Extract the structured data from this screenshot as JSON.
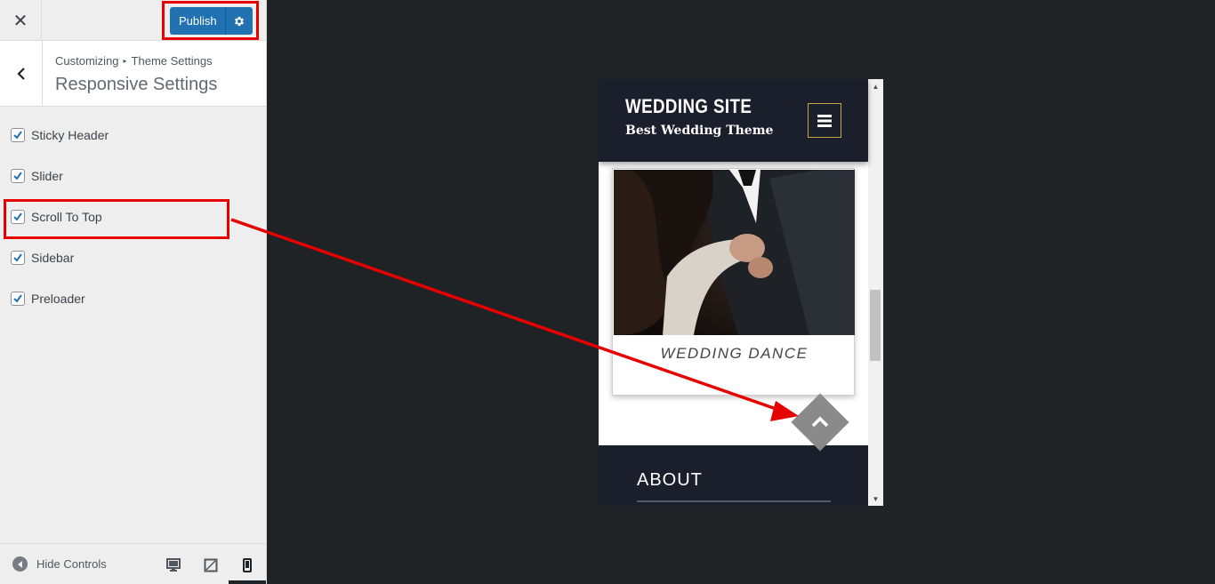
{
  "toolbar": {
    "close_icon": "close-icon",
    "publish_label": "Publish",
    "publish_settings_icon": "gear-icon",
    "accent_color": "#2271b1"
  },
  "section": {
    "breadcrumb_root": "Customizing",
    "breadcrumb_child": "Theme Settings",
    "title": "Responsive Settings"
  },
  "options": [
    {
      "label": "Sticky Header",
      "checked": true
    },
    {
      "label": "Slider",
      "checked": true
    },
    {
      "label": "Scroll To Top",
      "checked": true
    },
    {
      "label": "Sidebar",
      "checked": true
    },
    {
      "label": "Preloader",
      "checked": true
    }
  ],
  "footer": {
    "hide_controls_label": "Hide Controls",
    "devices": [
      "desktop-icon",
      "tablet-icon",
      "mobile-icon"
    ],
    "active_device": "mobile"
  },
  "preview": {
    "site_title": "WEDDING SITE",
    "site_tagline": "Best Wedding Theme",
    "card_caption": "WEDDING DANCE",
    "about_heading": "ABOUT",
    "header_color": "#1b1f2b",
    "menu_border_color": "#c9a24a"
  },
  "annotation_color": "#e60000"
}
